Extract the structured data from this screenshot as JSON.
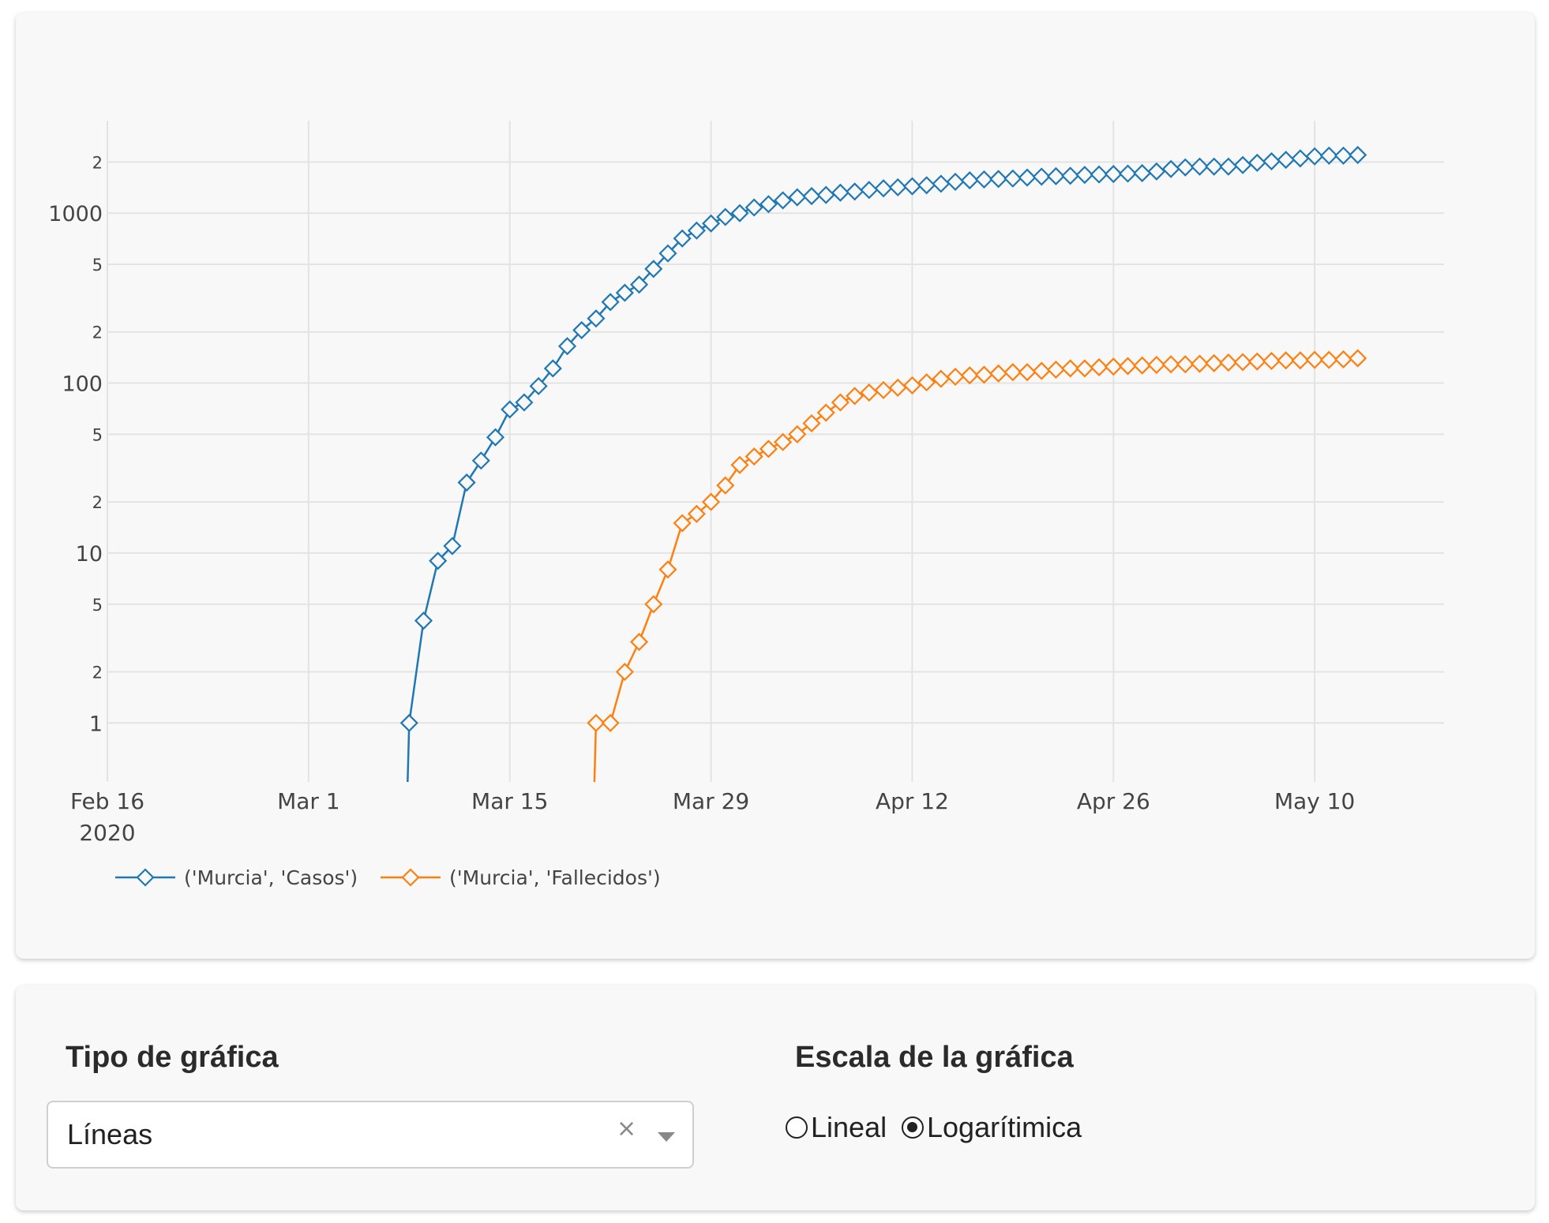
{
  "chart_data": {
    "type": "line",
    "title": "",
    "xlabel": "",
    "ylabel": "",
    "y_scale": "log",
    "x_axis": {
      "range": [
        "2020-02-16",
        "2020-05-19"
      ],
      "ticks": [
        {
          "date": "2020-02-16",
          "label": "Feb 16",
          "sublabel": "2020"
        },
        {
          "date": "2020-03-01",
          "label": "Mar 1",
          "sublabel": ""
        },
        {
          "date": "2020-03-15",
          "label": "Mar 15",
          "sublabel": ""
        },
        {
          "date": "2020-03-29",
          "label": "Mar 29",
          "sublabel": ""
        },
        {
          "date": "2020-04-12",
          "label": "Apr 12",
          "sublabel": ""
        },
        {
          "date": "2020-04-26",
          "label": "Apr 26",
          "sublabel": ""
        },
        {
          "date": "2020-05-10",
          "label": "May 10",
          "sublabel": ""
        }
      ]
    },
    "y_axis": {
      "range": [
        0.45,
        3500
      ],
      "ticks": [
        {
          "value": 1,
          "label": "1",
          "major": true
        },
        {
          "value": 2,
          "label": "2",
          "major": false
        },
        {
          "value": 5,
          "label": "5",
          "major": false
        },
        {
          "value": 10,
          "label": "10",
          "major": true
        },
        {
          "value": 20,
          "label": "2",
          "major": false
        },
        {
          "value": 50,
          "label": "5",
          "major": false
        },
        {
          "value": 100,
          "label": "100",
          "major": true
        },
        {
          "value": 200,
          "label": "2",
          "major": false
        },
        {
          "value": 500,
          "label": "5",
          "major": false
        },
        {
          "value": 1000,
          "label": "1000",
          "major": true
        },
        {
          "value": 2000,
          "label": "2",
          "major": false
        }
      ]
    },
    "grid": true,
    "legend_position": "bottom-left",
    "series": [
      {
        "name": "('Murcia', 'Casos')",
        "color": "#1f77b4",
        "marker": "diamond-open",
        "dates": [
          "2020-03-08",
          "2020-03-09",
          "2020-03-10",
          "2020-03-11",
          "2020-03-12",
          "2020-03-13",
          "2020-03-14",
          "2020-03-15",
          "2020-03-16",
          "2020-03-17",
          "2020-03-18",
          "2020-03-19",
          "2020-03-20",
          "2020-03-21",
          "2020-03-22",
          "2020-03-23",
          "2020-03-24",
          "2020-03-25",
          "2020-03-26",
          "2020-03-27",
          "2020-03-28",
          "2020-03-29",
          "2020-03-30",
          "2020-03-31",
          "2020-04-01",
          "2020-04-02",
          "2020-04-03",
          "2020-04-04",
          "2020-04-05",
          "2020-04-06",
          "2020-04-07",
          "2020-04-08",
          "2020-04-09",
          "2020-04-10",
          "2020-04-11",
          "2020-04-12",
          "2020-04-13",
          "2020-04-14",
          "2020-04-15",
          "2020-04-16",
          "2020-04-17",
          "2020-04-18",
          "2020-04-19",
          "2020-04-20",
          "2020-04-21",
          "2020-04-22",
          "2020-04-23",
          "2020-04-24",
          "2020-04-25",
          "2020-04-26",
          "2020-04-27",
          "2020-04-28",
          "2020-04-29",
          "2020-04-30",
          "2020-05-01",
          "2020-05-02",
          "2020-05-03",
          "2020-05-04",
          "2020-05-05",
          "2020-05-06",
          "2020-05-07",
          "2020-05-08",
          "2020-05-09",
          "2020-05-10",
          "2020-05-11",
          "2020-05-12",
          "2020-05-13"
        ],
        "values": [
          1,
          4,
          9,
          11,
          26,
          35,
          48,
          70,
          77,
          96,
          122,
          165,
          205,
          240,
          300,
          340,
          380,
          470,
          580,
          710,
          790,
          870,
          950,
          1000,
          1080,
          1130,
          1190,
          1240,
          1260,
          1280,
          1320,
          1340,
          1370,
          1400,
          1420,
          1440,
          1460,
          1490,
          1530,
          1560,
          1580,
          1590,
          1600,
          1620,
          1640,
          1650,
          1660,
          1680,
          1690,
          1700,
          1710,
          1720,
          1760,
          1820,
          1860,
          1880,
          1880,
          1880,
          1920,
          1980,
          2020,
          2060,
          2100,
          2160,
          2180,
          2180,
          2200
        ]
      },
      {
        "name": "('Murcia', 'Fallecidos')",
        "color": "#ff7f0e",
        "marker": "diamond-open",
        "dates": [
          "2020-03-21",
          "2020-03-22",
          "2020-03-23",
          "2020-03-24",
          "2020-03-25",
          "2020-03-26",
          "2020-03-27",
          "2020-03-28",
          "2020-03-29",
          "2020-03-30",
          "2020-03-31",
          "2020-04-01",
          "2020-04-02",
          "2020-04-03",
          "2020-04-04",
          "2020-04-05",
          "2020-04-06",
          "2020-04-07",
          "2020-04-08",
          "2020-04-09",
          "2020-04-10",
          "2020-04-11",
          "2020-04-12",
          "2020-04-13",
          "2020-04-14",
          "2020-04-15",
          "2020-04-16",
          "2020-04-17",
          "2020-04-18",
          "2020-04-19",
          "2020-04-20",
          "2020-04-21",
          "2020-04-22",
          "2020-04-23",
          "2020-04-24",
          "2020-04-25",
          "2020-04-26",
          "2020-04-27",
          "2020-04-28",
          "2020-04-29",
          "2020-04-30",
          "2020-05-01",
          "2020-05-02",
          "2020-05-03",
          "2020-05-04",
          "2020-05-05",
          "2020-05-06",
          "2020-05-07",
          "2020-05-08",
          "2020-05-09",
          "2020-05-10",
          "2020-05-11",
          "2020-05-12",
          "2020-05-13"
        ],
        "values": [
          1,
          1,
          2,
          3,
          5,
          8,
          15,
          17,
          20,
          25,
          33,
          37,
          41,
          45,
          50,
          58,
          67,
          77,
          84,
          88,
          91,
          94,
          97,
          101,
          106,
          109,
          111,
          112,
          114,
          116,
          116,
          118,
          120,
          122,
          122,
          124,
          125,
          126,
          127,
          128,
          129,
          129,
          130,
          131,
          132,
          133,
          134,
          135,
          136,
          136,
          137,
          137,
          138,
          140
        ]
      }
    ]
  },
  "controls": {
    "chart_type": {
      "title": "Tipo de gráfica",
      "selected": "Líneas",
      "clear_symbol": "×"
    },
    "scale": {
      "title": "Escala de la gráfica",
      "options": [
        {
          "label": "Lineal",
          "checked": false
        },
        {
          "label": "Logarítimica",
          "checked": true
        }
      ]
    }
  }
}
